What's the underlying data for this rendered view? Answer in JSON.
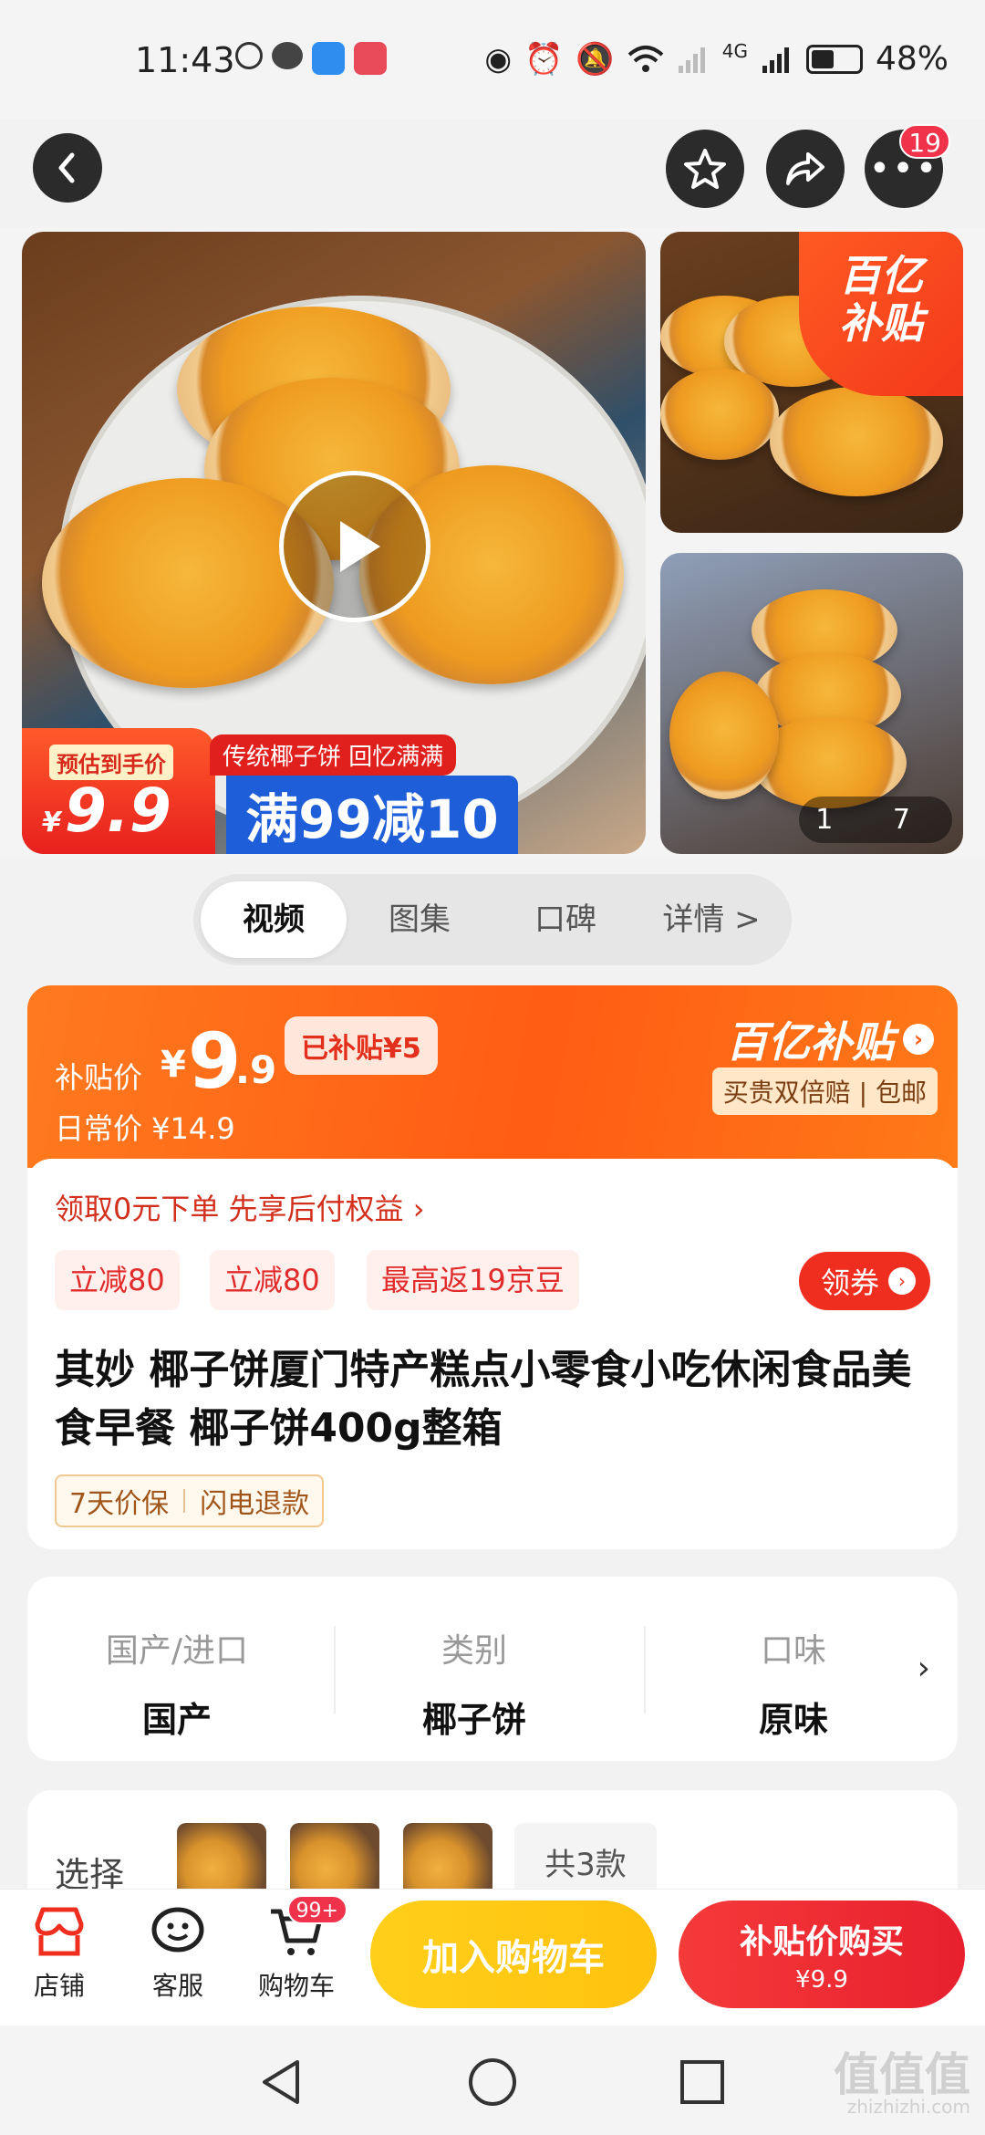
{
  "status_bar": {
    "time": "11:43",
    "battery_percent": "48%",
    "battery_level": 0.48,
    "network_label": "4G"
  },
  "top_nav": {
    "more_badge": "19"
  },
  "gallery": {
    "promo_price_label": "预估到手价",
    "promo_price_currency": "¥",
    "promo_price_value": "9.9",
    "promo_tag": "传统椰子饼 回忆满满",
    "promo_deal": "满99减10",
    "subsidy_corner_text": [
      "百亿",
      "补贴"
    ],
    "image_counter": "1 7"
  },
  "tabs": [
    {
      "label": "视频",
      "active": true
    },
    {
      "label": "图集",
      "active": false
    },
    {
      "label": "口碑",
      "active": false
    },
    {
      "label": "详情 >",
      "active": false
    }
  ],
  "price": {
    "subsidy_label": "补贴价",
    "subsidy_currency": "¥",
    "subsidy_int": "9",
    "subsidy_dec": ".9",
    "subsidized_chip": "已补贴¥5",
    "daily_price": "日常价 ¥14.9",
    "brand": "百亿补贴",
    "guarantee": "买贵双倍赔 | 包邮"
  },
  "offers": {
    "zero_order": "领取0元下单 先享后付权益 ›",
    "coupons": [
      "立减80",
      "立减80",
      "最高返19京豆"
    ],
    "get_coupon": "领券"
  },
  "product": {
    "title": "其妙 椰子饼厦门特产糕点小零食小吃休闲食品美食早餐 椰子饼400g整箱",
    "services": [
      "7天价保",
      "闪电退款"
    ]
  },
  "attributes": [
    {
      "key": "国产/进口",
      "value": "国产"
    },
    {
      "key": "类别",
      "value": "椰子饼"
    },
    {
      "key": "口味",
      "value": "原味"
    }
  ],
  "select": {
    "label": "选择",
    "count": "共3款"
  },
  "bottom_bar": {
    "shop": "店铺",
    "service": "客服",
    "cart": "购物车",
    "cart_badge": "99+",
    "add_to_cart": "加入购物车",
    "buy_line1": "补贴价购买",
    "buy_line2": "¥9.9"
  },
  "watermark": {
    "main": "值值值",
    "site": "zhizhizhi.com"
  },
  "colors": {
    "accent_red": "#ef2e1f",
    "subsidy_orange": "#ff5c14",
    "cart_yellow": "#ffc20e"
  }
}
